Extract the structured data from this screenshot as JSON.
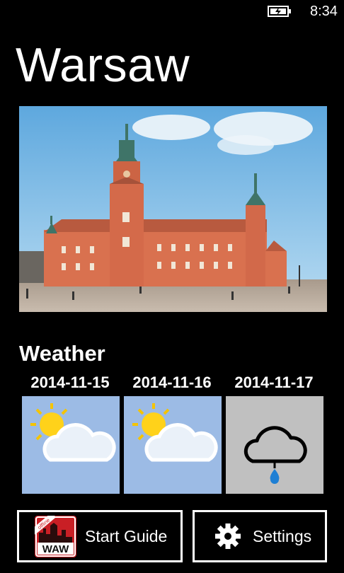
{
  "status_bar": {
    "time": "8:34",
    "battery_icon": "battery-charging-icon"
  },
  "page": {
    "title": "Warsaw"
  },
  "hero_image": {
    "icon": "royal-castle-photo"
  },
  "weather": {
    "label": "Weather",
    "days": [
      {
        "date": "2014-11-15",
        "condition": "partly-cloudy",
        "tile_color": "#9cbbe5"
      },
      {
        "date": "2014-11-16",
        "condition": "partly-cloudy",
        "tile_color": "#9cbbe5"
      },
      {
        "date": "2014-11-17",
        "condition": "rain",
        "tile_color": "#c0c0c0"
      }
    ]
  },
  "buttons": {
    "start_guide": {
      "label": "Start Guide",
      "logo_text": "WAW",
      "logo_badge": "offline"
    },
    "settings": {
      "label": "Settings",
      "icon": "gear-icon"
    }
  }
}
